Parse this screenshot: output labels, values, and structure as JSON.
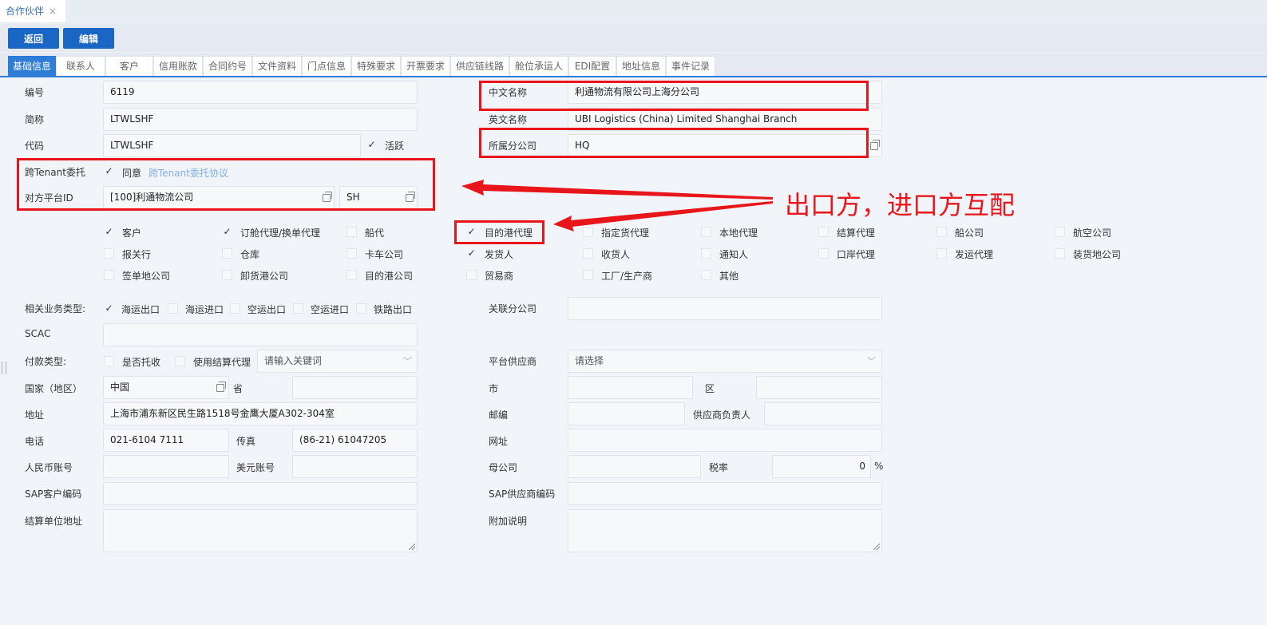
{
  "page_tab": {
    "title": "合作伙伴",
    "close": "×"
  },
  "toolbar": {
    "back": "返回",
    "edit": "编辑"
  },
  "tabs": [
    "基础信息",
    "联系人",
    "客户",
    "信用账款",
    "合同约号",
    "文件资料",
    "门点信息",
    "特殊要求",
    "开票要求",
    "供应链线路",
    "舱位承运人",
    "EDI配置",
    "地址信息",
    "事件记录"
  ],
  "form": {
    "code_label": "编号",
    "code_value": "6119",
    "short_label": "简称",
    "short_value": "LTWLSHF",
    "dm_label": "代码",
    "dm_value": "LTWLSHF",
    "active_label": "活跃",
    "cn_name_label": "中文名称",
    "cn_name_value": "利通物流有限公司上海分公司",
    "en_name_label": "英文名称",
    "en_name_value": "UBI Logistics (China) Limited Shanghai Branch",
    "branch_label": "所属分公司",
    "branch_value": "HQ",
    "tenant_label": "跨Tenant委托",
    "agree_label": "同意",
    "tenant_link": "跨Tenant委托协议",
    "platform_id_label": "对方平台ID",
    "platform_id_value": "[100]利通物流公司",
    "platform_code_value": "SH",
    "roles": [
      {
        "label": "客户",
        "checked": true
      },
      {
        "label": "订舱代理/换单代理",
        "checked": true
      },
      {
        "label": "船代",
        "checked": false
      },
      {
        "label": "目的港代理",
        "checked": true
      },
      {
        "label": "指定货代理",
        "checked": false
      },
      {
        "label": "本地代理",
        "checked": false
      },
      {
        "label": "结算代理",
        "checked": false
      },
      {
        "label": "船公司",
        "checked": false
      },
      {
        "label": "航空公司",
        "checked": false
      },
      {
        "label": "报关行",
        "checked": false
      },
      {
        "label": "仓库",
        "checked": false
      },
      {
        "label": "卡车公司",
        "checked": false
      },
      {
        "label": "发货人",
        "checked": true
      },
      {
        "label": "收货人",
        "checked": false
      },
      {
        "label": "通知人",
        "checked": false
      },
      {
        "label": "口岸代理",
        "checked": false
      },
      {
        "label": "发运代理",
        "checked": false
      },
      {
        "label": "装货地公司",
        "checked": false
      },
      {
        "label": "签单地公司",
        "checked": false
      },
      {
        "label": "卸货港公司",
        "checked": false
      },
      {
        "label": "目的港公司",
        "checked": false
      },
      {
        "label": "贸易商",
        "checked": false
      },
      {
        "label": "工厂/生产商",
        "checked": false
      },
      {
        "label": "其他",
        "checked": false
      }
    ],
    "biz_type_label": "相关业务类型:",
    "biz_types": [
      {
        "label": "海运出口",
        "checked": true
      },
      {
        "label": "海运进口",
        "checked": false
      },
      {
        "label": "空运出口",
        "checked": false
      },
      {
        "label": "空运进口",
        "checked": false
      },
      {
        "label": "铁路出口",
        "checked": false
      }
    ],
    "related_branch_label": "关联分公司",
    "scac_label": "SCAC",
    "pay_type_label": "付款类型:",
    "collect_label": "是否托收",
    "settle_agent_label": "使用结算代理",
    "keyword_placeholder": "请输入关键词",
    "platform_supplier_label": "平台供应商",
    "select_placeholder": "请选择",
    "country_label": "国家（地区）",
    "country_value": "中国",
    "province_label": "省",
    "city_label": "市",
    "district_label": "区",
    "address_label": "地址",
    "address_value": "上海市浦东新区民生路1518号金鹰大厦A302-304室",
    "postcode_label": "邮编",
    "supplier_owner_label": "供应商负责人",
    "phone_label": "电话",
    "phone_value": "021-6104 7111",
    "fax_label": "传真",
    "fax_value": "(86-21) 61047205",
    "website_label": "网址",
    "rmb_label": "人民币账号",
    "usd_label": "美元账号",
    "parent_label": "母公司",
    "tax_label": "税率",
    "tax_value": "0",
    "tax_unit": "%",
    "sap_cust_label": "SAP客户编码",
    "sap_supp_label": "SAP供应商编码",
    "settle_addr_label": "结算单位地址",
    "remark_label": "附加说明"
  },
  "annotation": {
    "text": "出口方，进口方互配",
    "color": "#e8161b"
  }
}
